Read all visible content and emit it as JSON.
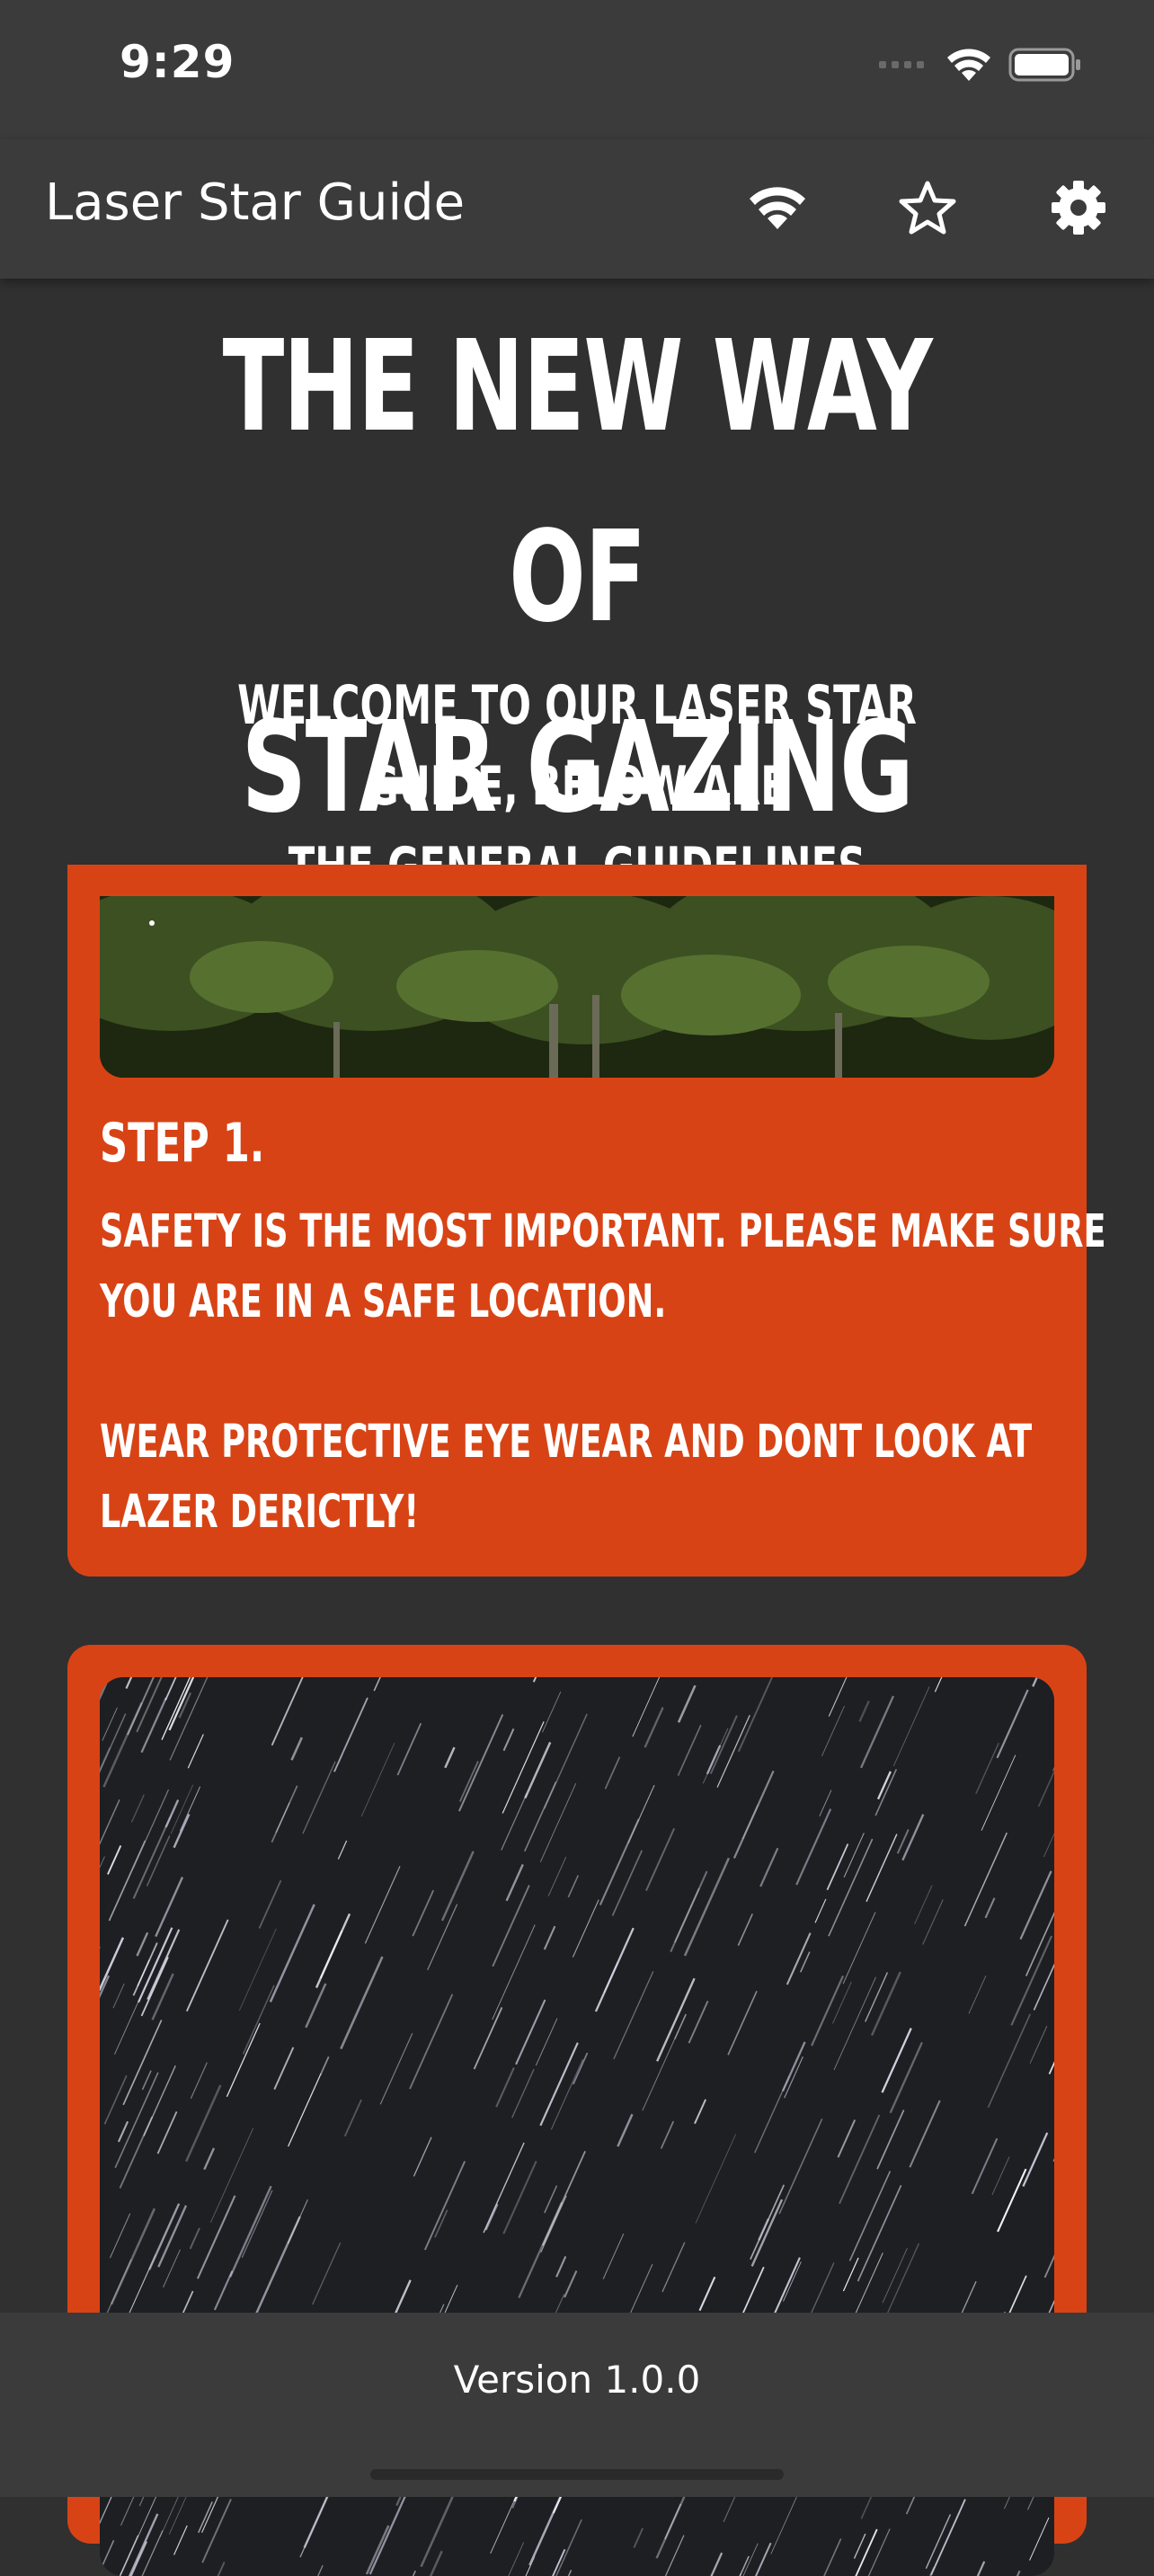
{
  "status_bar": {
    "time": "9:29",
    "icons": [
      "cellular-icon",
      "wifi-icon",
      "battery-icon"
    ]
  },
  "app_bar": {
    "title": "Laser Star Guide",
    "icons": [
      "wifi-icon",
      "star-icon",
      "settings-icon"
    ]
  },
  "hero": {
    "headline_line1": "THE NEW WAY OF",
    "headline_line2": "STAR GAZING",
    "subhead_line1": "WELCOME TO OUR LASER STAR GUIDE, BELOW ARE",
    "subhead_line2": "THE GENERAL GUIDELINES"
  },
  "steps": [
    {
      "title": "STEP 1.",
      "line1": "SAFETY IS THE MOST IMPORTANT. PLEASE MAKE SURE",
      "line2": "YOU ARE IN A SAFE LOCATION.",
      "line3": "WEAR PROTECTIVE EYE WEAR AND DONT LOOK AT",
      "line4": "LAZER DERICTLY!"
    }
  ],
  "footer": {
    "version": "Version 1.0.0"
  },
  "colors": {
    "accent": "#d84315",
    "background": "#303030",
    "bar": "#3b3b3b"
  }
}
